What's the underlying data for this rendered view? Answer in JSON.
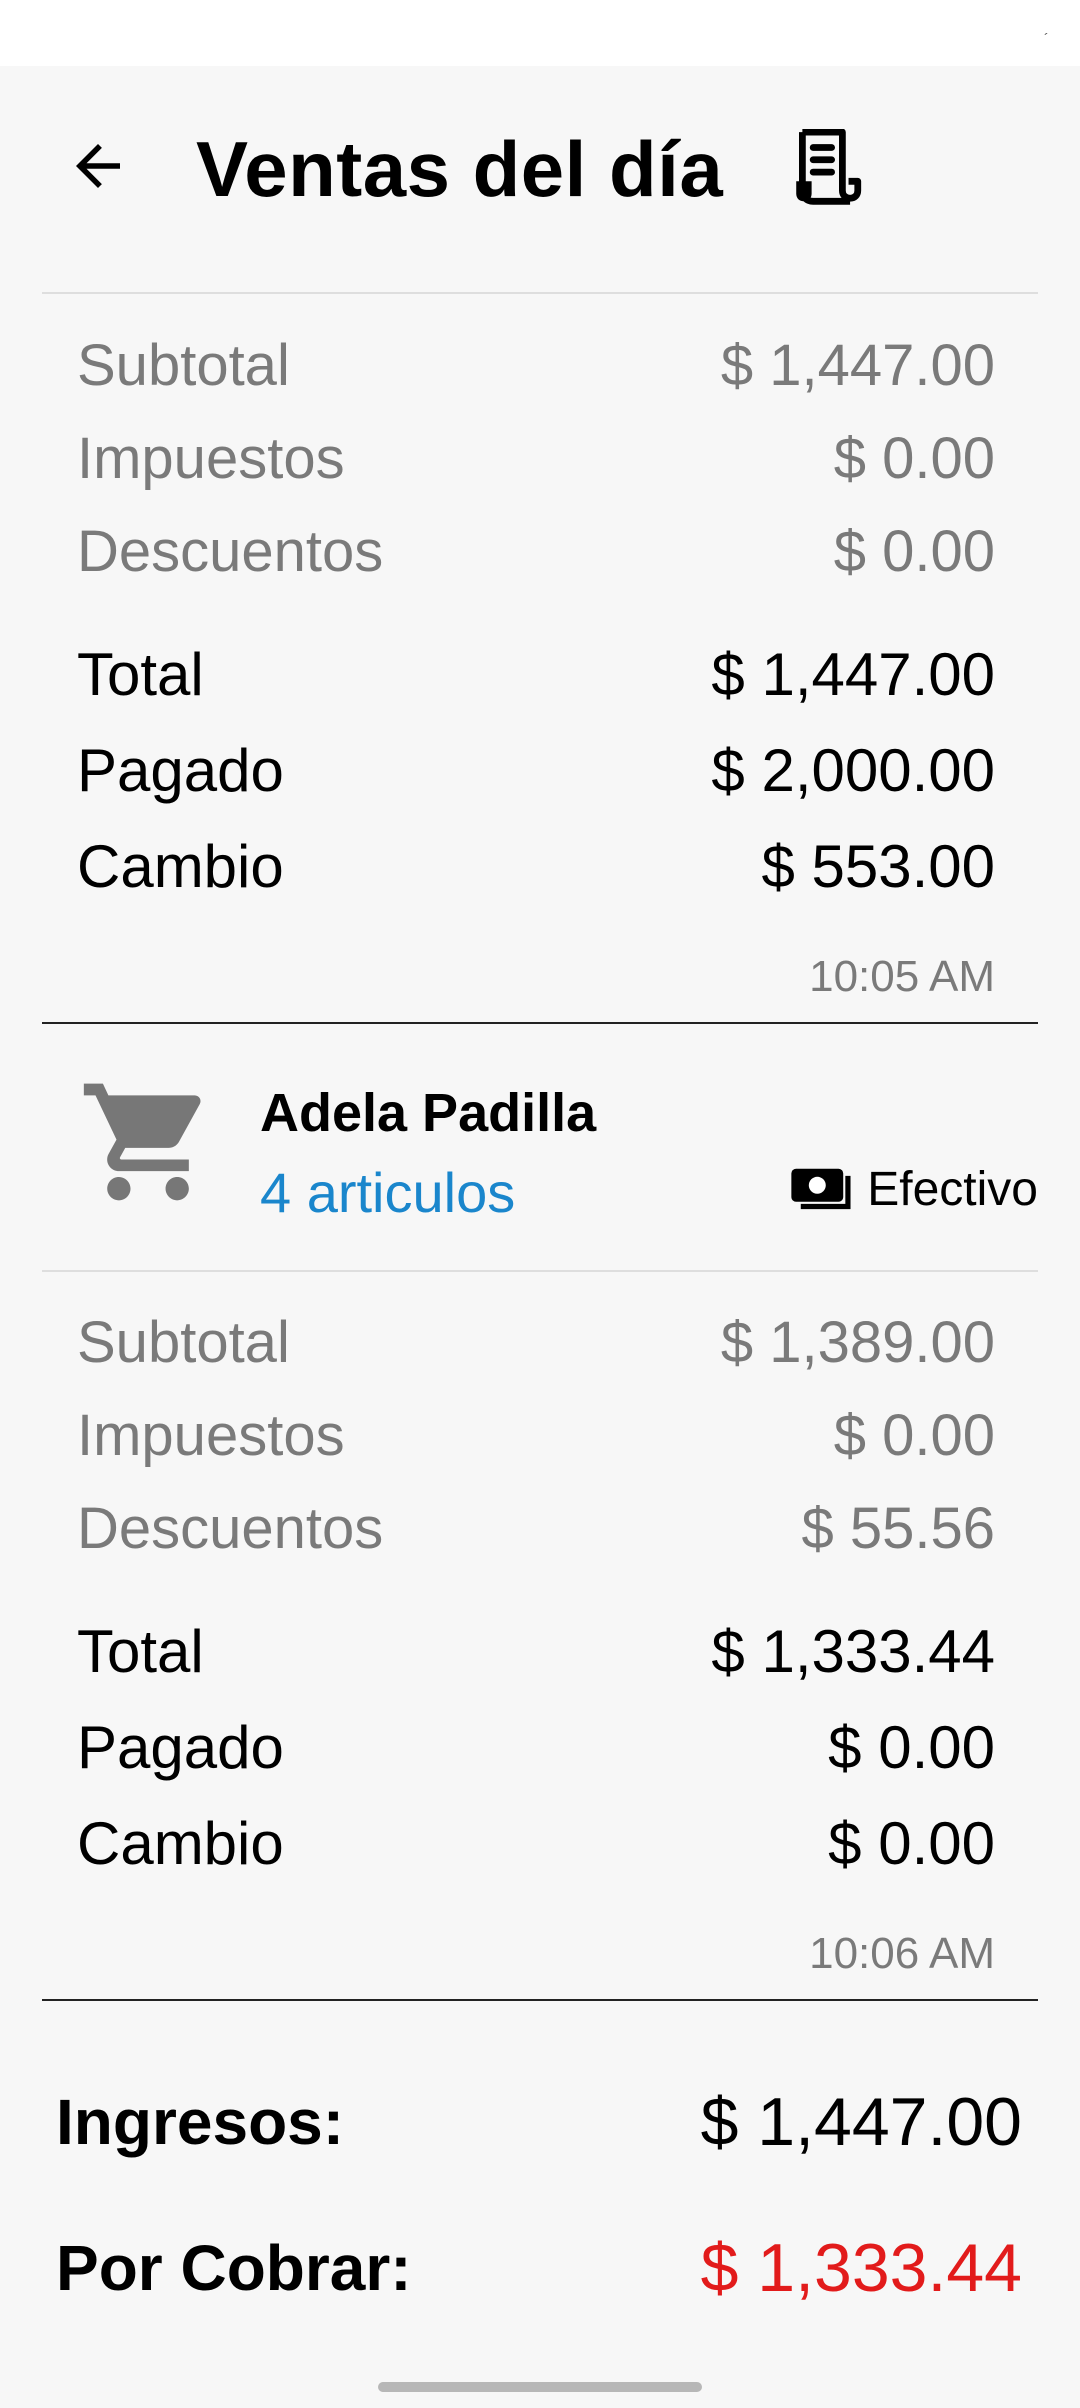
{
  "header": {
    "title": "Ventas del día"
  },
  "sale1": {
    "subtotal_label": "Subtotal",
    "subtotal": "$ 1,447.00",
    "tax_label": "Impuestos",
    "tax": "$ 0.00",
    "discount_label": "Descuentos",
    "discount": "$ 0.00",
    "total_label": "Total",
    "total": "$ 1,447.00",
    "paid_label": "Pagado",
    "paid": "$ 2,000.00",
    "change_label": "Cambio",
    "change": "$ 553.00",
    "time": "10:05 AM"
  },
  "sale2": {
    "customer": "Adela Padilla",
    "items": "4 articulos",
    "payment_method": "Efectivo",
    "subtotal_label": "Subtotal",
    "subtotal": "$ 1,389.00",
    "tax_label": "Impuestos",
    "tax": "$ 0.00",
    "discount_label": "Descuentos",
    "discount": "$ 55.56",
    "total_label": "Total",
    "total": "$ 1,333.44",
    "paid_label": "Pagado",
    "paid": "$ 0.00",
    "change_label": "Cambio",
    "change": "$ 0.00",
    "time": "10:06 AM"
  },
  "summary": {
    "income_label": "Ingresos:",
    "income": "$ 1,447.00",
    "pending_label": "Por Cobrar:",
    "pending": "$ 1,333.44"
  },
  "icons": {
    "back": "arrow-left-icon",
    "receipt": "receipt-icon",
    "cart": "cart-icon",
    "cash": "cash-icon"
  },
  "colors": {
    "accent": "#1a86cc",
    "pending": "#e21b1b",
    "muted": "#7a7a7a"
  }
}
